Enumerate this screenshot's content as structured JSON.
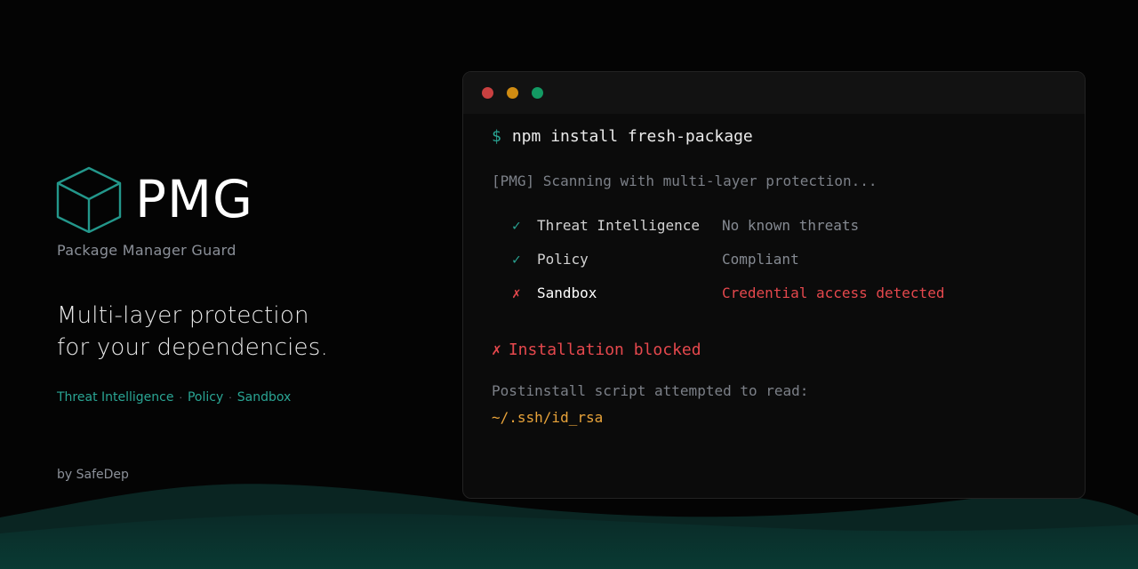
{
  "brand": {
    "name": "PMG",
    "subtitle": "Package Manager Guard",
    "tagline_line1": "Multi-layer protection",
    "tagline_line2": "for your dependencies.",
    "features": [
      "Threat Intelligence",
      "Policy",
      "Sandbox"
    ],
    "feature_separator": "·",
    "byline": "by SafeDep",
    "logo_icon": "cube-icon"
  },
  "terminal": {
    "window_controls": [
      "close",
      "minimize",
      "maximize"
    ],
    "prompt_symbol": "$",
    "command": "npm install fresh-package",
    "scan_message": "[PMG] Scanning with multi-layer protection...",
    "checks": [
      {
        "mark": "✓",
        "name": "Threat Intelligence",
        "status": "No known threats",
        "result": "pass"
      },
      {
        "mark": "✓",
        "name": "Policy",
        "status": "Compliant",
        "result": "pass"
      },
      {
        "mark": "✗",
        "name": "Sandbox",
        "status": "Credential access detected",
        "result": "fail"
      }
    ],
    "blocked_mark": "✗",
    "blocked_message": "Installation blocked",
    "detail_message": "Postinstall script attempted to read:",
    "detail_path": "~/.ssh/id_rsa"
  },
  "colors": {
    "accent": "#2aa594",
    "error": "#e5484d",
    "warning": "#e8a33a",
    "background": "#040404",
    "terminal_bg": "#0b0b0b",
    "dot_red": "#c94040",
    "dot_yellow": "#d08c12",
    "dot_green": "#139a63"
  }
}
